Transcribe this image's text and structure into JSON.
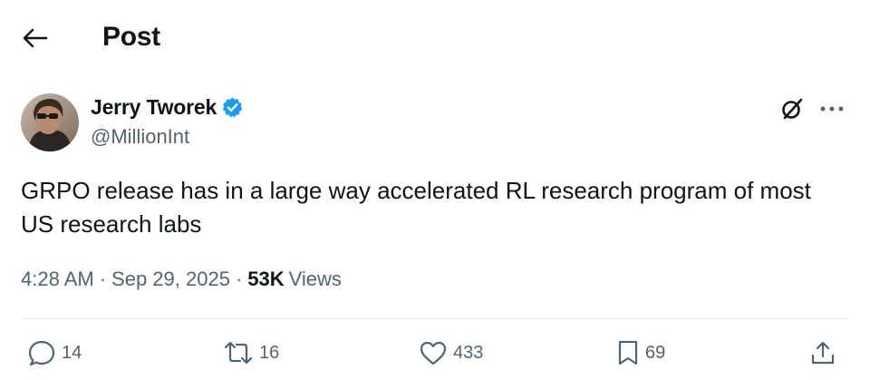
{
  "header": {
    "back_icon": "arrow-left-icon",
    "title": "Post"
  },
  "author": {
    "name": "Jerry Tworek",
    "handle": "@MillionInt",
    "verified": true,
    "verified_color": "#1d9bf0",
    "avatar": "profile-photo"
  },
  "post": {
    "text": "GRPO release has in a large way accelerated RL research program of most US research labs",
    "time": "4:28 AM",
    "date": "Sep 29, 2025",
    "views_count": "53K",
    "views_label": "Views",
    "separator": "·"
  },
  "actions": {
    "replies": "14",
    "reposts": "16",
    "likes": "433",
    "bookmarks": "69"
  },
  "colors": {
    "text": "#0f1419",
    "secondary": "#536471",
    "divider": "#eff3f4",
    "accent": "#1d9bf0"
  }
}
